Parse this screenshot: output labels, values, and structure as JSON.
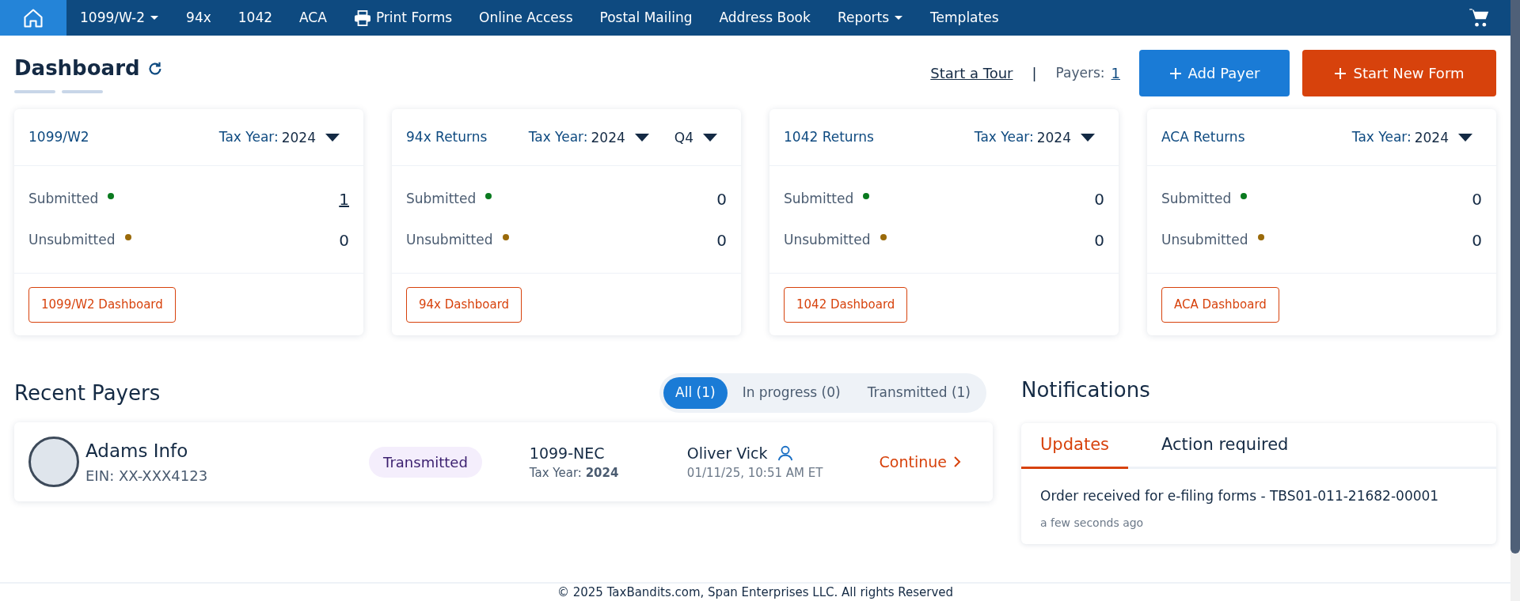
{
  "nav": {
    "items": [
      {
        "kind": "home",
        "selected": true
      },
      {
        "kind": "dropdown",
        "label": "1099/W-2",
        "selected": false
      },
      {
        "kind": "text",
        "label": "94x",
        "selected": false
      },
      {
        "kind": "text",
        "label": "1042",
        "selected": false
      },
      {
        "kind": "text",
        "label": "ACA",
        "selected": false
      },
      {
        "kind": "print",
        "label": "Print Forms",
        "selected": false
      },
      {
        "kind": "text",
        "label": "Online Access",
        "selected": false
      },
      {
        "kind": "text",
        "label": "Postal Mailing",
        "selected": false
      },
      {
        "kind": "text",
        "label": "Address Book",
        "selected": false
      },
      {
        "kind": "dropdown",
        "label": "Reports",
        "selected": false
      },
      {
        "kind": "text",
        "label": "Templates",
        "selected": false
      }
    ]
  },
  "header": {
    "title": "Dashboard",
    "tour_link": "Start a Tour",
    "separator": "|",
    "payers_label": "Payers:",
    "payers_count": "1",
    "add_payer": "Add Payer",
    "start_form": "Start New Form"
  },
  "cards": [
    {
      "title": "1099/W2",
      "selectors": [
        {
          "label": "Tax Year:",
          "value": "2024"
        }
      ],
      "stats": [
        {
          "label": "Submitted",
          "color": "#0a7a1f",
          "value": "1",
          "linked": true
        },
        {
          "label": "Unsubmitted",
          "color": "#9a6a0a",
          "value": "0",
          "linked": false
        }
      ],
      "button": "1099/W2 Dashboard"
    },
    {
      "title": "94x Returns",
      "selectors": [
        {
          "label": "Tax Year:",
          "value": "2024"
        },
        {
          "value": "Q4"
        }
      ],
      "stats": [
        {
          "label": "Submitted",
          "color": "#0a7a1f",
          "value": "0",
          "linked": false
        },
        {
          "label": "Unsubmitted",
          "color": "#9a6a0a",
          "value": "0",
          "linked": false
        }
      ],
      "button": "94x Dashboard"
    },
    {
      "title": "1042 Returns",
      "selectors": [
        {
          "label": "Tax Year:",
          "value": "2024"
        }
      ],
      "stats": [
        {
          "label": "Submitted",
          "color": "#0a7a1f",
          "value": "0",
          "linked": false
        },
        {
          "label": "Unsubmitted",
          "color": "#9a6a0a",
          "value": "0",
          "linked": false
        }
      ],
      "button": "1042 Dashboard"
    },
    {
      "title": "ACA Returns",
      "selectors": [
        {
          "label": "Tax Year:",
          "value": "2024"
        }
      ],
      "stats": [
        {
          "label": "Submitted",
          "color": "#0a7a1f",
          "value": "0",
          "linked": false
        },
        {
          "label": "Unsubmitted",
          "color": "#9a6a0a",
          "value": "0",
          "linked": false
        }
      ],
      "button": "ACA Dashboard"
    }
  ],
  "recent_payers": {
    "title": "Recent Payers",
    "filters": [
      {
        "label": "All (1)",
        "selected": true
      },
      {
        "label": "In progress (0)",
        "selected": false
      },
      {
        "label": "Transmitted (1)",
        "selected": false
      }
    ],
    "rows": [
      {
        "name": "Adams Info",
        "ein": "EIN: XX-XXX4123",
        "status": "Transmitted",
        "form": "1099-NEC",
        "tax_year": "Tax Year: **2024**",
        "user": "Oliver Vick",
        "timestamp": "01/11/25, 10:51 AM ET",
        "action": "Continue"
      }
    ]
  },
  "notifications": {
    "title": "Notifications",
    "tabs": [
      {
        "label": "Updates",
        "selected": true
      },
      {
        "label": "Action required",
        "selected": false
      }
    ],
    "items": [
      {
        "text": "Order received for e-filing forms - TBS01-011-21682-00001",
        "time": "a few seconds ago"
      }
    ]
  },
  "footer": {
    "text": "© 2025 TaxBandits.com, Span Enterprises LLC. All rights Reserved"
  }
}
